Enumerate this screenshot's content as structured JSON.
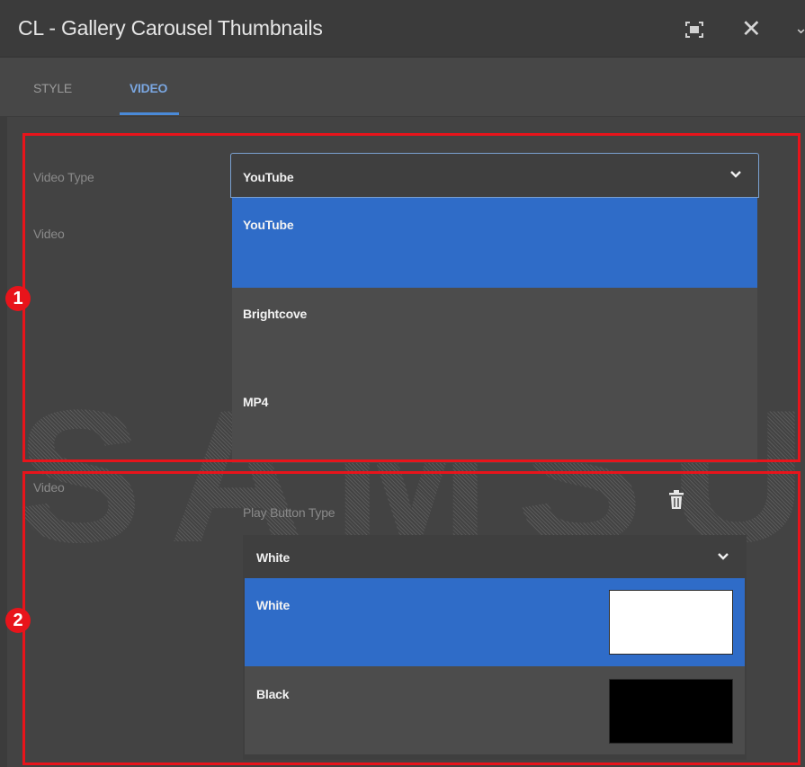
{
  "window": {
    "title": "CL - Gallery Carousel Thumbnails",
    "fullscreen_icon": "fullscreen-icon",
    "close_icon": "close-icon",
    "close_glyph": "✕",
    "more_icon": "chevron-icon",
    "more_glyph": "⌄"
  },
  "tabs": [
    {
      "label": "STYLE",
      "active": false
    },
    {
      "label": "VIDEO",
      "active": true
    }
  ],
  "watermark": "SAMSUNG",
  "annotations": [
    {
      "number": "1",
      "color": "#e8141b"
    },
    {
      "number": "2",
      "color": "#e8141b"
    }
  ],
  "section1": {
    "video_type_label": "Video Type",
    "video_label": "Video",
    "select_value": "YouTube",
    "options": [
      {
        "label": "YouTube",
        "selected": true
      },
      {
        "label": "Brightcove",
        "selected": false
      },
      {
        "label": "MP4",
        "selected": false
      }
    ]
  },
  "section2": {
    "video_label": "Video",
    "play_button_type_label": "Play Button Type",
    "delete_icon": "trash-icon",
    "select_value": "White",
    "options": [
      {
        "label": "White",
        "selected": true,
        "swatch": "#ffffff"
      },
      {
        "label": "Black",
        "selected": false,
        "swatch": "#000000"
      }
    ]
  },
  "colors": {
    "accent": "#2f6cc8",
    "tab_active": "#4a8ad8",
    "annotation": "#e8141b"
  }
}
